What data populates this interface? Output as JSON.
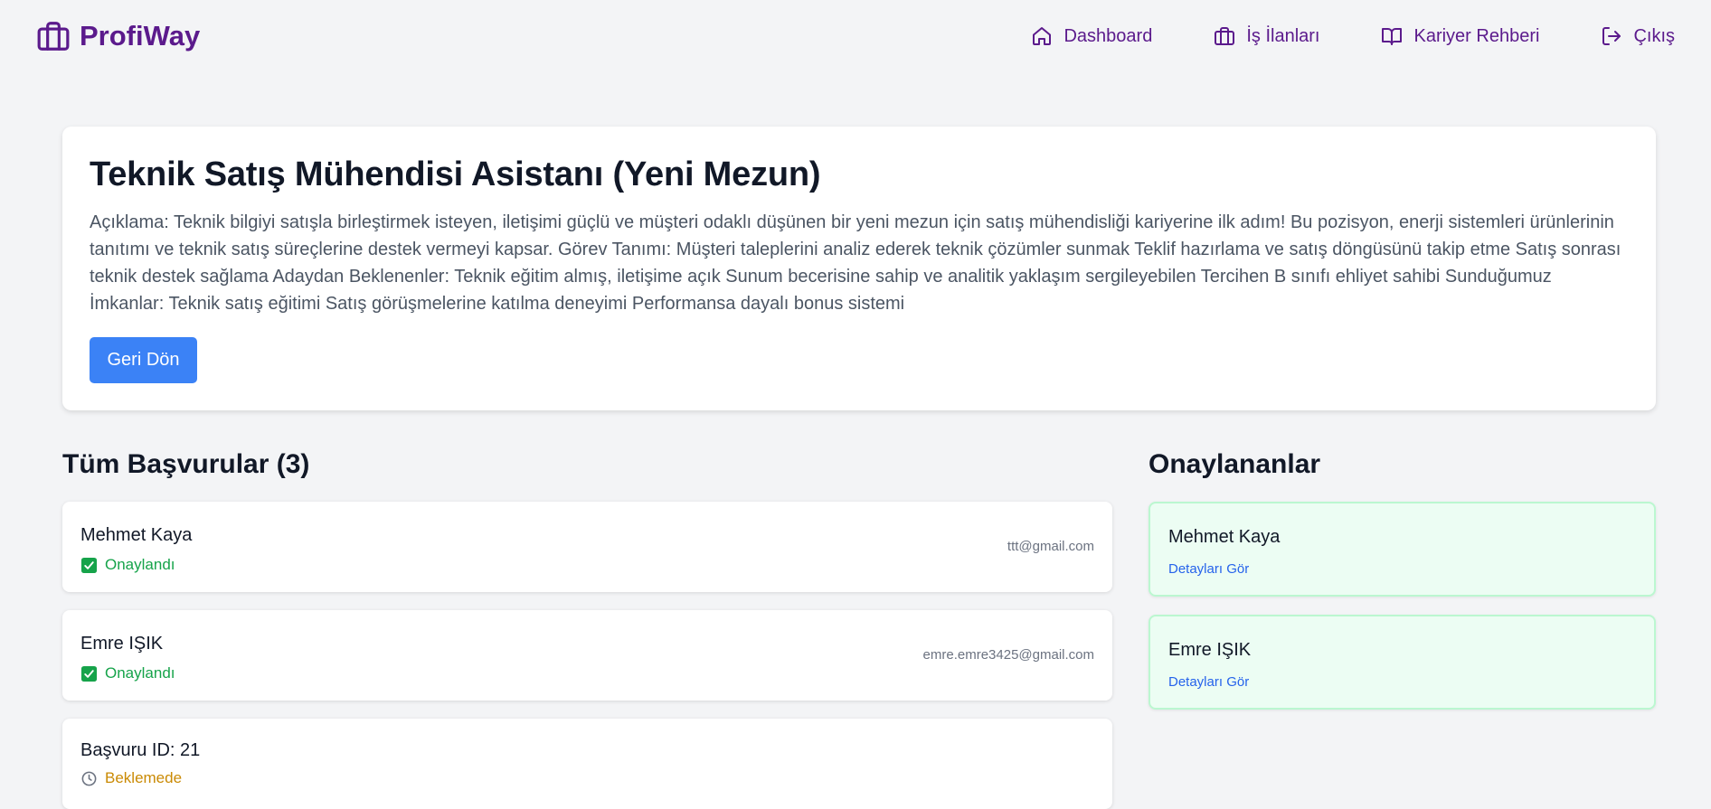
{
  "brand": {
    "name": "ProfiWay",
    "icon": "briefcase-icon",
    "color": "#5b1a8c"
  },
  "nav": [
    {
      "label": "Dashboard",
      "icon": "home-icon"
    },
    {
      "label": "İş İlanları",
      "icon": "briefcase-icon"
    },
    {
      "label": "Kariyer Rehberi",
      "icon": "book-open-icon"
    },
    {
      "label": "Çıkış",
      "icon": "logout-icon"
    }
  ],
  "job": {
    "title": "Teknik Satış Mühendisi Asistanı (Yeni Mezun)",
    "description": "Açıklama: Teknik bilgiyi satışla birleştirmek isteyen, iletişimi güçlü ve müşteri odaklı düşünen bir yeni mezun için satış mühendisliği kariyerine ilk adım! Bu pozisyon, enerji sistemleri ürünlerinin tanıtımı ve teknik satış süreçlerine destek vermeyi kapsar. Görev Tanımı: Müşteri taleplerini analiz ederek teknik çözümler sunmak Teklif hazırlama ve satış döngüsünü takip etme Satış sonrası teknik destek sağlama Adaydan Beklenenler: Teknik eğitim almış, iletişime açık Sunum becerisine sahip ve analitik yaklaşım sergileyebilen Tercihen B sınıfı ehliyet sahibi Sunduğumuz İmkanlar: Teknik satış eğitimi Satış görüşmelerine katılma deneyimi Performansa dayalı bonus sistemi",
    "back_label": "Geri Dön"
  },
  "applications": {
    "title": "Tüm Başvurular (3)",
    "items": [
      {
        "name": "Mehmet Kaya",
        "status": "Onaylandı",
        "status_icon": "check-square-icon",
        "email": "ttt@gmail.com"
      },
      {
        "name": "Emre IŞIK",
        "status": "Onaylandı",
        "status_icon": "check-square-icon",
        "email": "emre.emre3425@gmail.com"
      },
      {
        "name": "Başvuru ID: 21",
        "status": "Beklemede",
        "status_icon": "clock-icon",
        "email": ""
      }
    ]
  },
  "approved": {
    "title": "Onaylananlar",
    "items": [
      {
        "name": "Mehmet Kaya",
        "link": "Detayları Gör"
      },
      {
        "name": "Emre IŞIK",
        "link": "Detayları Gör"
      }
    ]
  },
  "colors": {
    "accent": "#3b82f6",
    "success": "#16a34a",
    "pending": "#ca8a04",
    "link": "#2563eb"
  }
}
